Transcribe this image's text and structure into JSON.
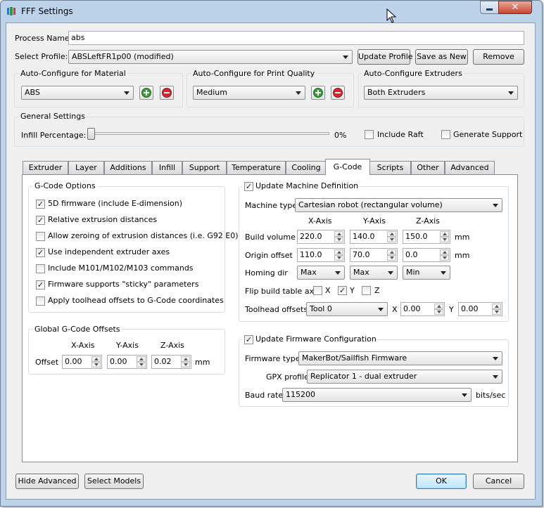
{
  "window": {
    "title": "FFF Settings",
    "close_symbol": "✕"
  },
  "process_name": {
    "label": "Process Name:",
    "value": "abs"
  },
  "profile": {
    "label": "Select Profile:",
    "value": "ABSLeftFR1p00 (modified)",
    "update_button": "Update Profile",
    "save_as_button": "Save as New",
    "remove_button": "Remove"
  },
  "auto_material": {
    "title": "Auto-Configure for Material",
    "value": "ABS"
  },
  "auto_quality": {
    "title": "Auto-Configure for Print Quality",
    "value": "Medium"
  },
  "auto_extruders": {
    "title": "Auto-Configure Extruders",
    "value": "Both Extruders"
  },
  "general": {
    "title": "General Settings",
    "infill_label": "Infill Percentage:",
    "infill_value": "0%",
    "infill_fraction": 0,
    "raft_label": "Include Raft",
    "raft_checked": false,
    "support_label": "Generate Support",
    "support_checked": false
  },
  "tabs": [
    "Extruder",
    "Layer",
    "Additions",
    "Infill",
    "Support",
    "Temperature",
    "Cooling",
    "G-Code",
    "Scripts",
    "Other",
    "Advanced"
  ],
  "active_tab": "G-Code",
  "gcode_options": {
    "title": "G-Code Options",
    "items": [
      {
        "label": "5D firmware (include E-dimension)",
        "checked": true
      },
      {
        "label": "Relative extrusion distances",
        "checked": true
      },
      {
        "label": "Allow zeroing of extrusion distances (i.e. G92 E0)",
        "checked": false
      },
      {
        "label": "Use independent extruder axes",
        "checked": true
      },
      {
        "label": "Include M101/M102/M103 commands",
        "checked": false
      },
      {
        "label": "Firmware supports \"sticky\" parameters",
        "checked": true
      },
      {
        "label": "Apply toolhead offsets to G-Code coordinates",
        "checked": false
      }
    ]
  },
  "global_offsets": {
    "title": "Global G-Code Offsets",
    "x_header": "X-Axis",
    "y_header": "Y-Axis",
    "z_header": "Z-Axis",
    "row_label": "Offset",
    "x": "0.00",
    "y": "0.00",
    "z": "0.02",
    "unit": "mm"
  },
  "machine": {
    "title": "Update Machine Definition",
    "checked": true,
    "type_label": "Machine type",
    "type_value": "Cartesian robot (rectangular volume)",
    "x_header": "X-Axis",
    "y_header": "Y-Axis",
    "z_header": "Z-Axis",
    "build_label": "Build volume",
    "build": [
      "220.0",
      "140.0",
      "150.0"
    ],
    "build_unit": "mm",
    "origin_label": "Origin offset",
    "origin": [
      "110.0",
      "70.0",
      "0.0"
    ],
    "origin_unit": "mm",
    "homing_label": "Homing dir",
    "homing": [
      "Max",
      "Max",
      "Min"
    ],
    "flip_label": "Flip build table axis",
    "flip_x_label": "X",
    "flip_x": false,
    "flip_y_label": "Y",
    "flip_y": true,
    "flip_z_label": "Z",
    "flip_z": false,
    "toolhead_label": "Toolhead offsets",
    "toolhead_value": "Tool 0",
    "tx_label": "X",
    "tx": "0.00",
    "ty_label": "Y",
    "ty": "0.00"
  },
  "firmware": {
    "title": "Update Firmware Configuration",
    "checked": true,
    "type_label": "Firmware type",
    "type_value": "MakerBot/Sailfish Firmware",
    "gpx_label": "GPX profile",
    "gpx_value": "Replicator 1 - dual extruder",
    "baud_label": "Baud rate",
    "baud_value": "115200",
    "baud_unit": "bits/sec"
  },
  "footer": {
    "hide_advanced": "Hide Advanced",
    "select_models": "Select Models",
    "ok": "OK",
    "cancel": "Cancel"
  },
  "check_mark": "✓"
}
